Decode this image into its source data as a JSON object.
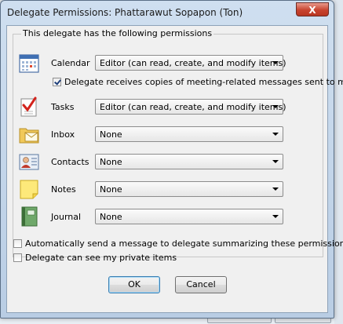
{
  "dialog": {
    "title": "Delegate Permissions: Phattarawut Sopapon (Ton)",
    "close_glyph": "X"
  },
  "group": {
    "label": "This delegate has the following permissions"
  },
  "permissions": [
    {
      "label": "Calendar",
      "value": "Editor (can read, create, and modify items)",
      "icon": "calendar-icon"
    },
    {
      "label": "Tasks",
      "value": "Editor (can read, create, and modify items)",
      "icon": "tasks-icon"
    },
    {
      "label": "Inbox",
      "value": "None",
      "icon": "inbox-icon"
    },
    {
      "label": "Contacts",
      "value": "None",
      "icon": "contacts-icon"
    },
    {
      "label": "Notes",
      "value": "None",
      "icon": "notes-icon"
    },
    {
      "label": "Journal",
      "value": "None",
      "icon": "journal-icon"
    }
  ],
  "meeting_copies": {
    "label": "Delegate receives copies of meeting-related messages sent to me",
    "checked": true
  },
  "options": {
    "auto_send_label": "Automatically send a message to delegate summarizing these permissions",
    "auto_send_checked": false,
    "private_items_label": "Delegate can see my private items",
    "private_items_checked": false
  },
  "buttons": {
    "ok": "OK",
    "cancel": "Cancel"
  }
}
